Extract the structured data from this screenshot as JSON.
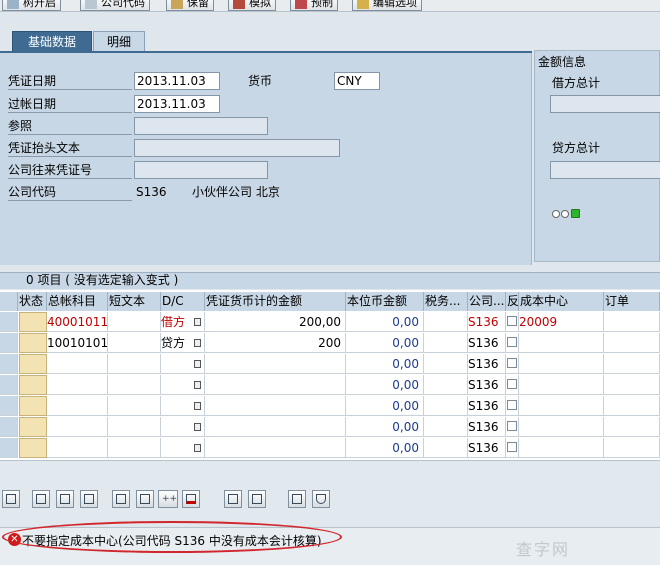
{
  "toolbar": {
    "buttons": [
      "树开启",
      "公司代码",
      "保留",
      "模拟",
      "预制",
      "编辑选项"
    ]
  },
  "tabs": {
    "basic": "基础数据",
    "detail": "明细"
  },
  "header": {
    "doc_date_label": "凭证日期",
    "doc_date": "2013.11.03",
    "currency_label": "货币",
    "currency": "CNY",
    "posting_date_label": "过帐日期",
    "posting_date": "2013.11.03",
    "reference_label": "参照",
    "header_text_label": "凭证抬头文本",
    "intercompany_label": "公司往来凭证号",
    "company_code_label": "公司代码",
    "company_code": "S136",
    "company_name": "小伙伴公司 北京"
  },
  "amount_info": {
    "title": "金额信息",
    "debit_label": "借方总计",
    "credit_label": "贷方总计"
  },
  "items": {
    "title": "0 项目 ( 没有选定输入变式 )",
    "columns": [
      "状态",
      "总帐科目",
      "短文本",
      "D/C",
      "凭证货币计的金额",
      "本位币金额",
      "税务...",
      "公司...",
      "反",
      "成本中心",
      "订单"
    ],
    "rows": [
      {
        "account": "40001011",
        "dc": "借方",
        "amount": "200,00",
        "local": "0,00",
        "company": "S136",
        "cost_center": "20009"
      },
      {
        "account": "10010101",
        "dc": "贷方",
        "amount": "200",
        "local": "0,00",
        "company": "S136",
        "cost_center": ""
      },
      {
        "account": "",
        "dc": "",
        "amount": "",
        "local": "0,00",
        "company": "S136",
        "cost_center": ""
      },
      {
        "account": "",
        "dc": "",
        "amount": "",
        "local": "0,00",
        "company": "S136",
        "cost_center": ""
      },
      {
        "account": "",
        "dc": "",
        "amount": "",
        "local": "0,00",
        "company": "S136",
        "cost_center": ""
      },
      {
        "account": "",
        "dc": "",
        "amount": "",
        "local": "0,00",
        "company": "S136",
        "cost_center": ""
      },
      {
        "account": "",
        "dc": "",
        "amount": "",
        "local": "0,00",
        "company": "S136",
        "cost_center": ""
      }
    ]
  },
  "status": {
    "message": "不要指定成本中心(公司代码 S136 中没有成本会计核算)"
  },
  "watermark": "查字网",
  "colors": {
    "accent": "#3f6b93",
    "error": "#d01818",
    "highlight_oval": "#d0262c"
  }
}
